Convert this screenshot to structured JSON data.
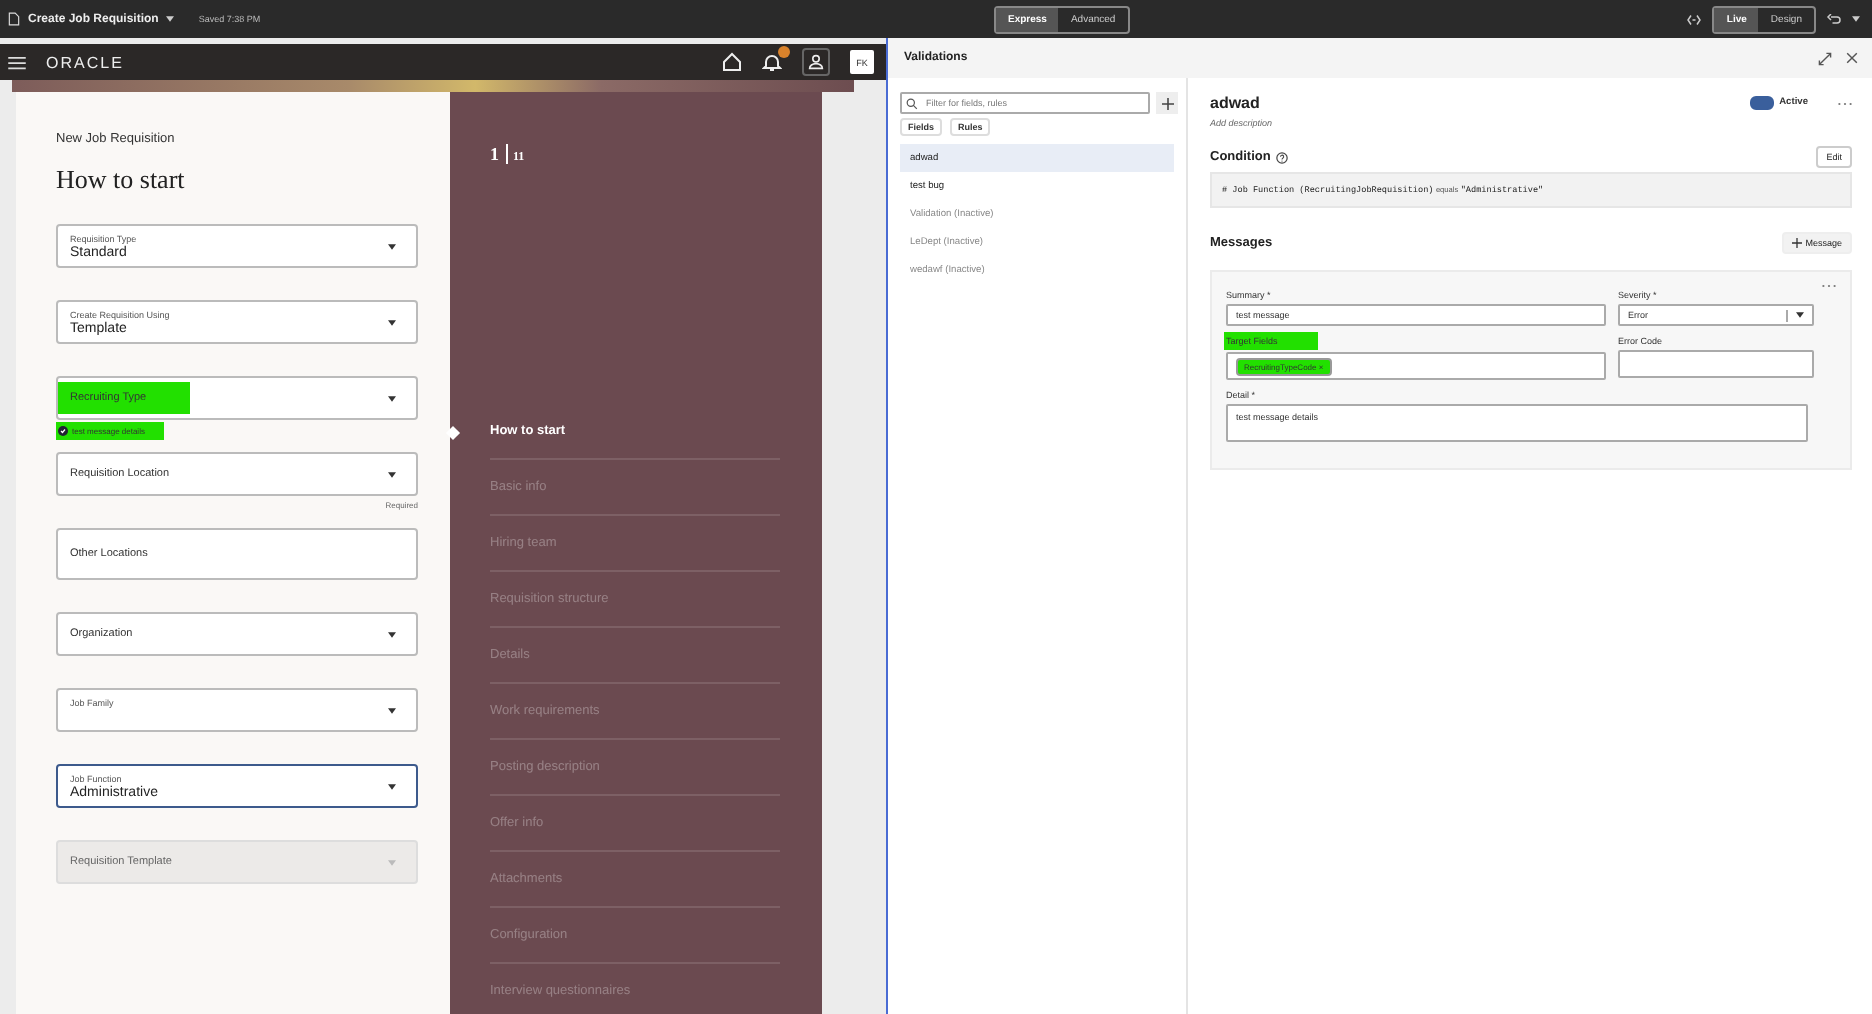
{
  "top_bar": {
    "doc_title": "Create Job Requisition",
    "saved": "Saved 7:38 PM",
    "modes": [
      {
        "label": "Express",
        "selected": true
      },
      {
        "label": "Advanced",
        "selected": false
      }
    ],
    "views": [
      {
        "label": "Live",
        "selected": true
      },
      {
        "label": "Design",
        "selected": false
      }
    ]
  },
  "app_header": {
    "logo": "ORACLE",
    "avatar": "FK"
  },
  "form": {
    "subtitle": "New Job Requisition",
    "title": "How to start",
    "fields": [
      {
        "label": "Requisition Type",
        "value": "Standard",
        "kind": "select",
        "floated": true,
        "focused": false,
        "disabled": false,
        "highlighted": false
      },
      {
        "label": "Create Requisition Using",
        "value": "Template",
        "kind": "select",
        "floated": true,
        "focused": false,
        "disabled": false,
        "highlighted": false
      },
      {
        "label": "Recruiting Type",
        "kind": "select",
        "floated": false,
        "focused": false,
        "disabled": false,
        "highlighted": true,
        "error": "test message details"
      },
      {
        "label": "Requisition Location",
        "kind": "select",
        "floated": false,
        "focused": false,
        "disabled": false,
        "highlighted": false,
        "helper": "Required"
      },
      {
        "label": "Other Locations",
        "kind": "text",
        "floated": false,
        "focused": false,
        "disabled": false,
        "highlighted": false
      },
      {
        "label": "Organization",
        "kind": "select",
        "floated": false,
        "focused": false,
        "disabled": false,
        "highlighted": false
      },
      {
        "label": "Job Family",
        "kind": "select",
        "floated": true,
        "focused": false,
        "disabled": false,
        "highlighted": false
      },
      {
        "label": "Job Function",
        "value": "Administrative",
        "kind": "select",
        "floated": true,
        "focused": true,
        "disabled": false,
        "highlighted": false
      },
      {
        "label": "Requisition Template",
        "kind": "select",
        "floated": false,
        "focused": false,
        "disabled": true,
        "highlighted": false
      }
    ]
  },
  "stepper": {
    "current": "1",
    "total": "11",
    "steps": [
      {
        "label": "How to start",
        "selected": true
      },
      {
        "label": "Basic info",
        "selected": false
      },
      {
        "label": "Hiring team",
        "selected": false
      },
      {
        "label": "Requisition structure",
        "selected": false
      },
      {
        "label": "Details",
        "selected": false
      },
      {
        "label": "Work requirements",
        "selected": false
      },
      {
        "label": "Posting description",
        "selected": false
      },
      {
        "label": "Offer info",
        "selected": false
      },
      {
        "label": "Attachments",
        "selected": false
      },
      {
        "label": "Configuration",
        "selected": false
      },
      {
        "label": "Interview questionnaires",
        "selected": false
      }
    ]
  },
  "validations": {
    "title": "Validations",
    "search": {
      "placeholder": "Filter for fields, rules"
    },
    "filters": [
      {
        "label": "Fields"
      },
      {
        "label": "Rules"
      }
    ],
    "rules": [
      {
        "name": "adwad",
        "selected": true,
        "inactive": false
      },
      {
        "name": "test bug",
        "selected": false,
        "inactive": false
      },
      {
        "name": "Validation (Inactive)",
        "selected": false,
        "inactive": true
      },
      {
        "name": "LeDept (Inactive)",
        "selected": false,
        "inactive": true
      },
      {
        "name": "wedawf (Inactive)",
        "selected": false,
        "inactive": true
      }
    ],
    "detail": {
      "name": "adwad",
      "active_label": "Active",
      "on": true,
      "description_placeholder": "Add description",
      "condition_title": "Condition",
      "edit": "Edit",
      "condition": {
        "field": "# Job Function (RecruitingJobRequisition)",
        "operator": "equals",
        "value": "\"Administrative\""
      },
      "messages_title": "Messages",
      "add_message": "Message",
      "message": {
        "summary_label": "Summary *",
        "summary": "test message",
        "severity_label": "Severity *",
        "severity": "Error",
        "target_label": "Target Fields",
        "target_chips": [
          {
            "label": "RecruitingTypeCode",
            "remove": "×"
          }
        ],
        "error_code_label": "Error Code",
        "detail_label": "Detail *",
        "detail": "test message details",
        "highlighted": true
      }
    }
  }
}
